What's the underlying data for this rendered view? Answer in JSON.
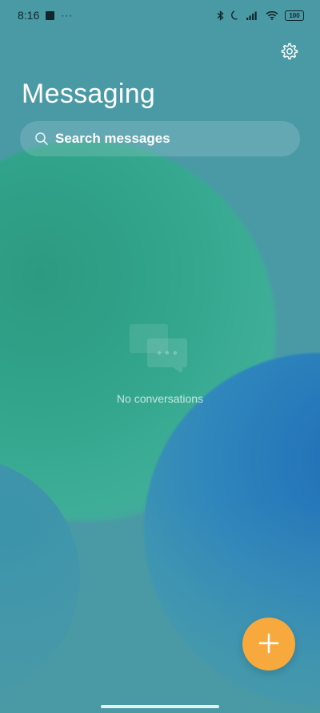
{
  "status_bar": {
    "time": "8:16",
    "more_indicator": "···",
    "battery_level": "100",
    "icons": [
      "notification-square-icon",
      "bluetooth-icon",
      "moon-icon",
      "signal-icon",
      "wifi-icon",
      "battery-icon"
    ]
  },
  "header": {
    "title": "Messaging",
    "settings_icon": "gear-icon"
  },
  "search": {
    "placeholder": "Search messages",
    "value": "",
    "icon": "search-icon"
  },
  "empty_state": {
    "icon": "chat-bubbles-icon",
    "text": "No conversations"
  },
  "fab": {
    "icon": "plus-icon",
    "color": "#f7a93e"
  },
  "colors": {
    "background": "#4a9aa6",
    "accent": "#f7a93e",
    "text": "#ffffff"
  }
}
